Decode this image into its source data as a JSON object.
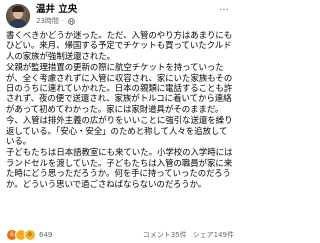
{
  "post": {
    "author_name": "温井 立央",
    "timestamp": "23時間",
    "visibility_icon": "globe-icon",
    "more_icon": "more-options-icon",
    "paragraphs": [
      "書くべきかどうか迷った。ただ、入管のやり方はあまりにもひどい。来月、帰国する予定でチケットも買っていたクルド人の家族が強制送還された。",
      "父親が監理措置の更新の際に航空チケットを持っていったが、全く考慮されずに入管に収容され、家にいた家族もその日のうちに連れていかれた。日本の親類に電話することも許されず、夜の便で送還され、家族がトルコに着いてから連絡があって初めてわかった。家には家財道具がそのままだ。",
      "今、入管は排外主義の広がりをいいことに強引な送還を繰り返している。「安心・安全」のためと称して人々を追放している。",
      "子どもたちは日本語教室にも来ていた。小学校の入学時にはランドセルを渡していた。子どもたちは入管の職員が家に来た時にどう思っただろうか。何を手に持っていったのだろうか。どういう思いで過ごさねばならないのだろうか。"
    ],
    "reactions": {
      "icons": [
        "angry-react-icon",
        "sad-react-icon",
        "wow-react-icon"
      ],
      "count": "649",
      "comments": "コメント35件",
      "shares": "シェア149件"
    }
  }
}
